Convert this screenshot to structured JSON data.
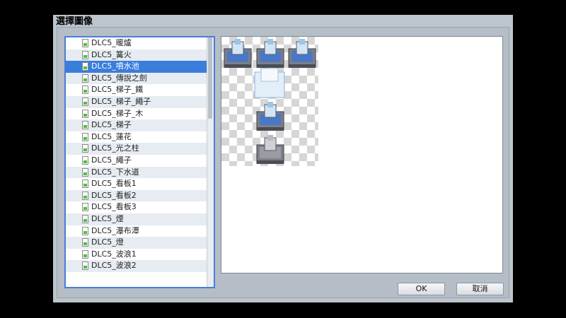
{
  "dialog": {
    "title": "選擇圖像"
  },
  "file_list": {
    "items": [
      {
        "label": "DLC5_暖爐"
      },
      {
        "label": "DLC5_篝火"
      },
      {
        "label": "DLC5_噴水池"
      },
      {
        "label": "DLC5_傳說之劍"
      },
      {
        "label": "DLC5_梯子_鐵"
      },
      {
        "label": "DLC5_梯子_繩子"
      },
      {
        "label": "DLC5_梯子_木"
      },
      {
        "label": "DLC5_梯子"
      },
      {
        "label": "DLC5_蓮花"
      },
      {
        "label": "DLC5_光之柱"
      },
      {
        "label": "DLC5_繩子"
      },
      {
        "label": "DLC5_下水道"
      },
      {
        "label": "DLC5_看板1"
      },
      {
        "label": "DLC5_看板2"
      },
      {
        "label": "DLC5_看板3"
      },
      {
        "label": "DLC5_煙"
      },
      {
        "label": "DLC5_瀑布潭"
      },
      {
        "label": "DLC5_燈"
      },
      {
        "label": "DLC5_波浪1"
      },
      {
        "label": "DLC5_波浪2"
      }
    ],
    "selected_index": 2,
    "file_icon": "image-file-icon"
  },
  "buttons": {
    "ok_label": "OK",
    "cancel_label": "取消"
  },
  "colors": {
    "selection": "#3b7ddb",
    "list_border": "#4a7dd8",
    "dialog_bg": "#bcc4cc",
    "file_icon_green": "#4fbf3a"
  }
}
